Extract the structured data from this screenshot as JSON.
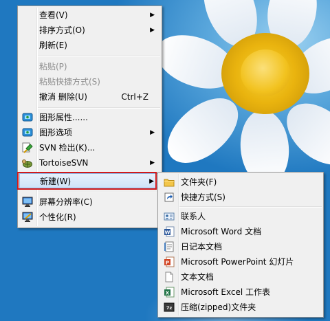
{
  "context_menu": {
    "items": [
      {
        "label": "查看(V)",
        "submenu": true
      },
      {
        "label": "排序方式(O)",
        "submenu": true
      },
      {
        "label": "刷新(E)"
      },
      {
        "label": "粘贴(P)",
        "disabled": true
      },
      {
        "label": "粘贴快捷方式(S)",
        "disabled": true
      },
      {
        "label": "撤消 删除(U)",
        "shortcut": "Ctrl+Z"
      },
      {
        "label": "图形属性......"
      },
      {
        "label": "图形选项",
        "submenu": true
      },
      {
        "label": "SVN 检出(K)..."
      },
      {
        "label": "TortoiseSVN",
        "submenu": true
      },
      {
        "label": "新建(W)",
        "submenu": true,
        "highlighted": true
      },
      {
        "label": "屏幕分辨率(C)"
      },
      {
        "label": "个性化(R)"
      }
    ],
    "arrow_glyph": "▶"
  },
  "new_submenu": {
    "items": [
      {
        "label": "文件夹(F)",
        "icon": "folder-icon"
      },
      {
        "label": "快捷方式(S)",
        "icon": "shortcut-icon"
      },
      {
        "label": "联系人",
        "icon": "contact-icon"
      },
      {
        "label": "Microsoft Word 文档",
        "icon": "word-doc-icon"
      },
      {
        "label": "日记本文档",
        "icon": "journal-icon"
      },
      {
        "label": "Microsoft PowerPoint 幻灯片",
        "icon": "powerpoint-icon"
      },
      {
        "label": "文本文档",
        "icon": "text-doc-icon"
      },
      {
        "label": "Microsoft Excel 工作表",
        "icon": "excel-icon"
      },
      {
        "label": "压缩(zipped)文件夹",
        "icon": "zip-folder-icon"
      }
    ]
  },
  "colors": {
    "highlight_border": "#d11a1a",
    "menu_bg": "#f0f0f0",
    "disabled_text": "#8d8d8d"
  }
}
